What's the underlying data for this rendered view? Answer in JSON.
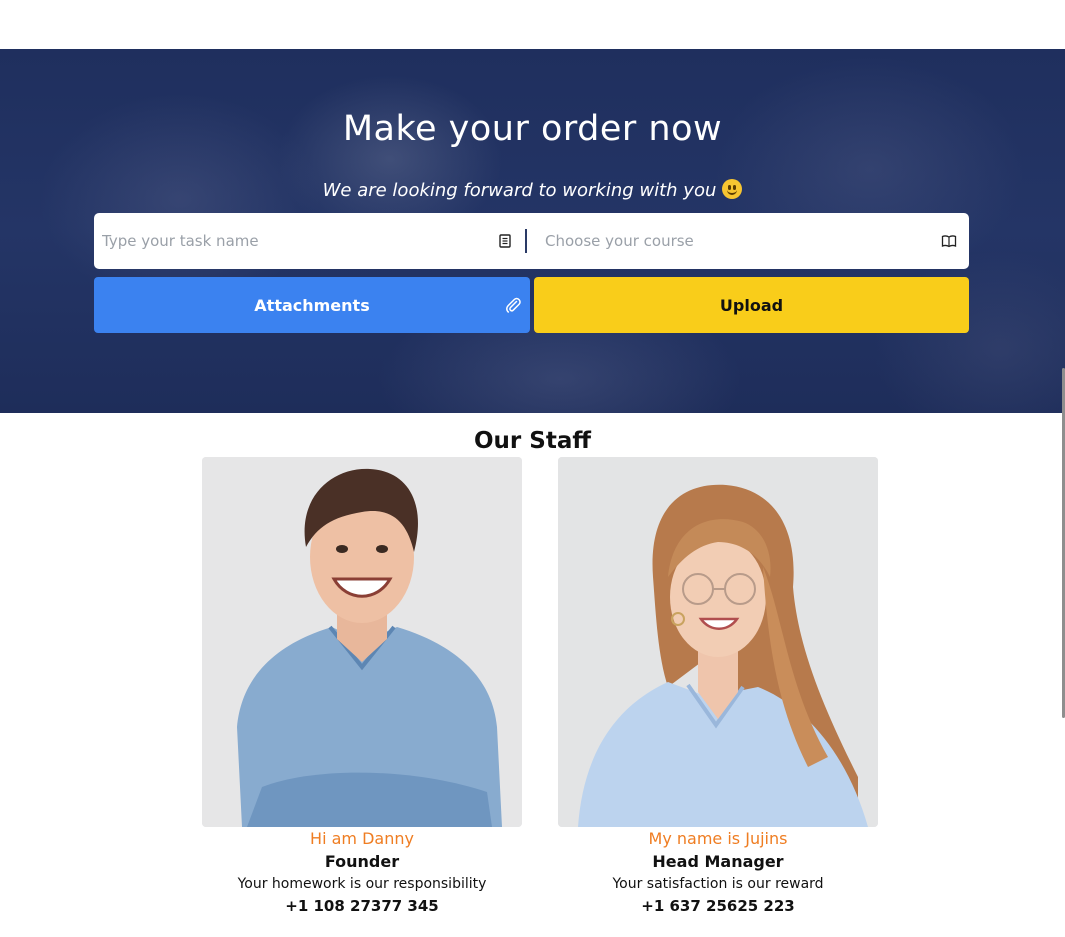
{
  "hero": {
    "title": "Make your order now",
    "subtitle": "We are looking forward to working with you",
    "emoji": "smiley-emoji"
  },
  "form": {
    "task_placeholder": "Type your task name",
    "course_placeholder": "Choose your course",
    "attachments_label": "Attachments",
    "upload_label": "Upload"
  },
  "staff": {
    "title": "Our Staff",
    "members": [
      {
        "greeting": "Hi am Danny",
        "role": "Founder",
        "tagline": "Your homework is our responsibility",
        "phone": "+1 108 27377 345"
      },
      {
        "greeting": "My name is Jujins",
        "role": "Head Manager",
        "tagline": "Your satisfaction is our reward",
        "phone": "+1 637 25625 223"
      }
    ]
  },
  "colors": {
    "hero_bg": "#22325f",
    "attach_btn": "#3b82f0",
    "upload_btn": "#f9cd1a",
    "accent_orange": "#ef7d22"
  },
  "icons": [
    "notepad-icon",
    "book-icon",
    "paperclip-icon"
  ]
}
